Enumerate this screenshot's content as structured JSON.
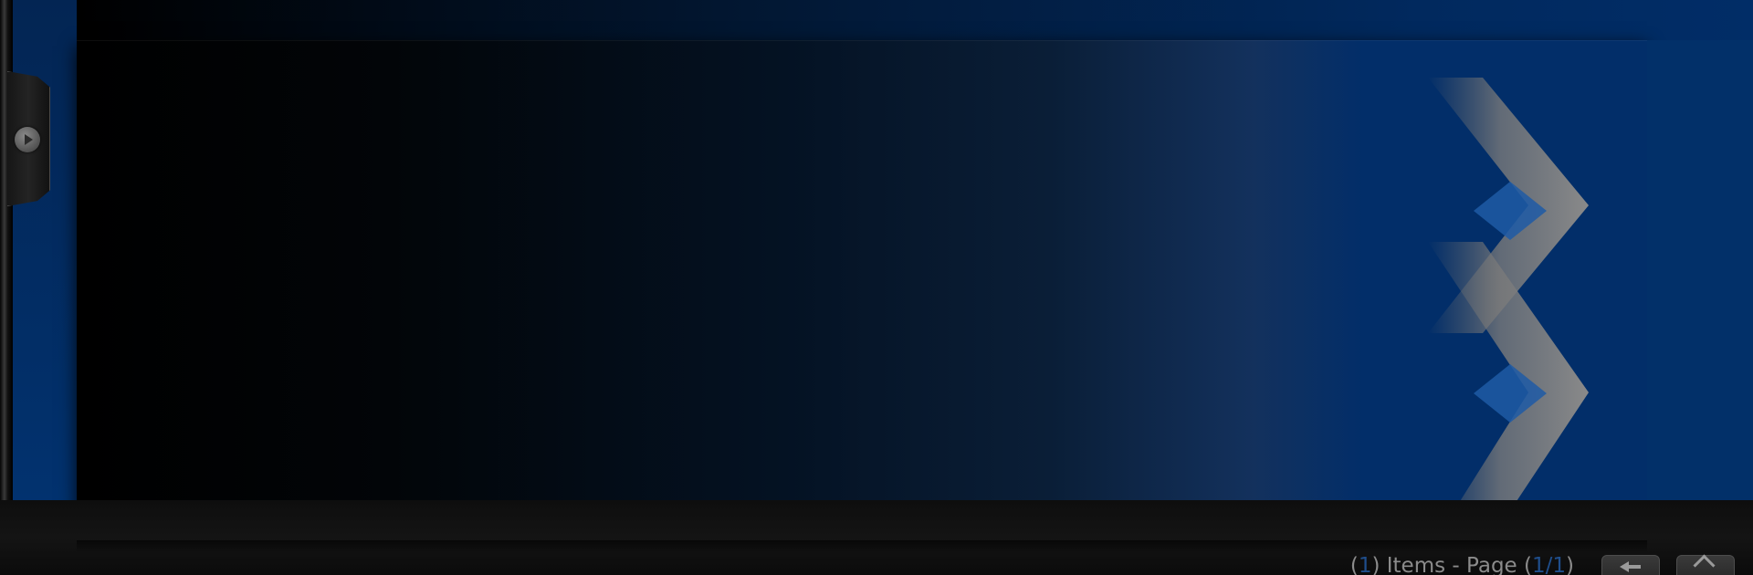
{
  "footer": {
    "items_count": "1",
    "items_label": "Items - Page (",
    "page_current": "1",
    "page_separator": "/",
    "page_total": "1",
    "open_paren": "(",
    "close_paren_1": ") ",
    "close_paren_2": ")"
  },
  "icons": {
    "side_tab": "play-icon",
    "back": "back-arrow-icon",
    "home": "home-icon"
  },
  "colors": {
    "background_blue": "#012d67",
    "accent_blue": "#1f4e8c",
    "text_gray": "#8b8b8b"
  }
}
